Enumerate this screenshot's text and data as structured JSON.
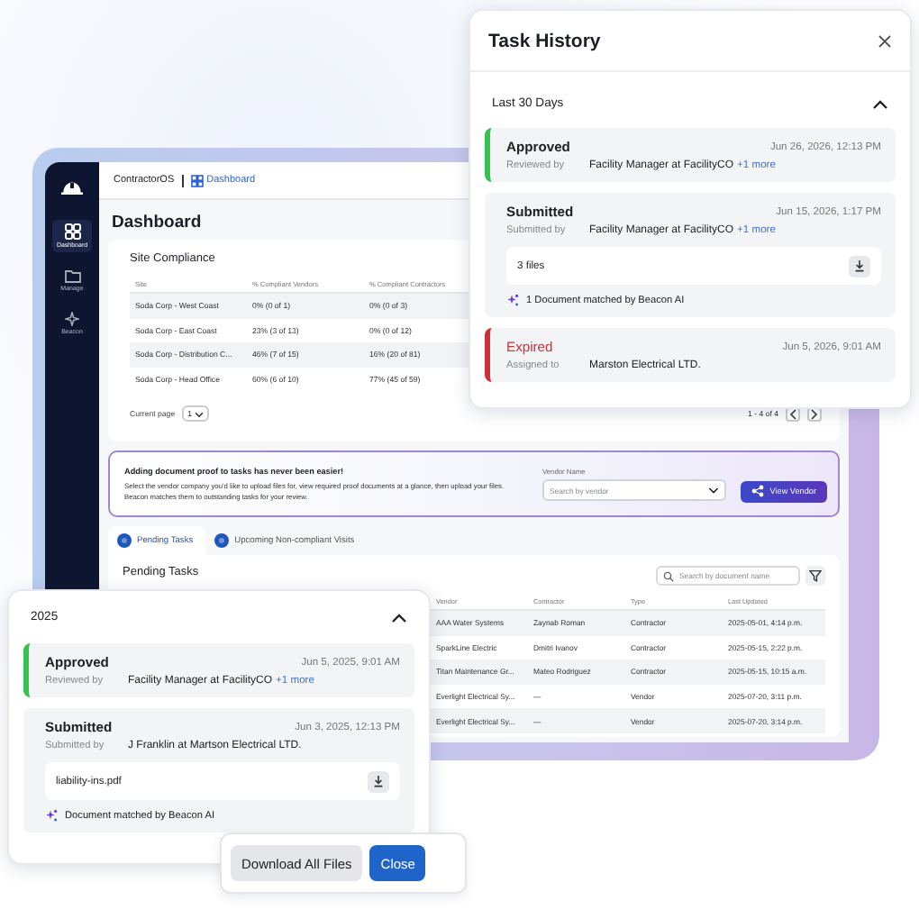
{
  "app": {
    "name": "ContractorOS",
    "breadcrumb": "Dashboard"
  },
  "sidebar": {
    "items": [
      {
        "label": "Dashboard",
        "selected": true
      },
      {
        "label": "Manage",
        "selected": false
      },
      {
        "label": "Beacon",
        "selected": false
      }
    ]
  },
  "page_title": "Dashboard",
  "site_compliance": {
    "title": "Site Compliance",
    "columns": [
      "Site",
      "% Compliant Vendors",
      "% Compliant Contractors"
    ],
    "rows": [
      [
        "Soda Corp - West Coast",
        "0% (0 of 1)",
        "0% (0 of 3)"
      ],
      [
        "Soda Corp - East Coast",
        "23% (3 of 13)",
        "0% (0 of 12)"
      ],
      [
        "Soda Corp - Distribution C...",
        "46% (7 of 15)",
        "16% (20 of 81)"
      ],
      [
        "Soda Corp - Head Office",
        "60% (6 of 10)",
        "77% (45 of 59)"
      ]
    ],
    "current_page_label": "Current page",
    "page": "1",
    "range": "1 - 4 of 4"
  },
  "banner": {
    "title": "Adding document proof to tasks has never been easier!",
    "text": "Select the vendor company you'd like to upload files for, view required proof documents at a glance, then upload your files. Beacon matches them to outstanding tasks for your review.",
    "field_label": "Vendor Name",
    "placeholder": "Search by vendor",
    "button": "View Vendor"
  },
  "tabs": [
    {
      "label": "Pending Tasks",
      "selected": true
    },
    {
      "label": "Upcoming Non-compliant Visits",
      "selected": false
    }
  ],
  "pending_tasks": {
    "title": "Pending Tasks",
    "search_placeholder": "Search by document name",
    "columns": [
      "Vendor",
      "Contractor",
      "Type",
      "Last Updated"
    ],
    "rows": [
      [
        "AAA Water Systems",
        "Zaynab Roman",
        "Contractor",
        "2025-05-01, 4:14 p.m."
      ],
      [
        "SparkLine Electric",
        "Dmitri Ivanov",
        "Contractor",
        "2025-05-15, 2:22 p.m."
      ],
      [
        "Titan Maintenance Gr...",
        "Mateo Rodriguez",
        "Contractor",
        "2025-05-15, 10:15 a.m."
      ],
      [
        "Everlight Electrical Sy...",
        "—",
        "Vendor",
        "2025-07-20, 3:11 p.m."
      ],
      [
        "Everlight Electrical Sy...",
        "—",
        "Vendor",
        "2025-07-20, 3:14 p.m."
      ]
    ]
  },
  "task_history": {
    "title": "Task History",
    "group": {
      "label": "Last 30 Days",
      "expanded": true,
      "entries": [
        {
          "kind": "approved",
          "status": "Approved",
          "date": "Jun 26, 2026, 12:13 PM",
          "by_label": "Reviewed by",
          "by": "Facility Manager at FacilityCO",
          "more": "+1 more"
        },
        {
          "kind": "submitted",
          "status": "Submitted",
          "date": "Jun 15, 2026, 1:17 PM",
          "by_label": "Submitted by",
          "by": "Facility Manager at FacilityCO",
          "more": "+1 more",
          "file": "3 files",
          "match": "1 Document matched by Beacon AI"
        },
        {
          "kind": "expired",
          "status": "Expired",
          "date": "Jun 5, 2026, 9:01 AM",
          "by_label": "Assigned to",
          "by": "Marston Electrical LTD."
        }
      ]
    }
  },
  "history_2025": {
    "label": "2025",
    "expanded": true,
    "entries": [
      {
        "kind": "approved",
        "status": "Approved",
        "date": "Jun 5, 2025, 9:01 AM",
        "by_label": "Reviewed by",
        "by": "Facility Manager at FacilityCO",
        "more": "+1 more"
      },
      {
        "kind": "submitted",
        "status": "Submitted",
        "date": "Jun 3, 2025, 12:13 PM",
        "by_label": "Submitted by",
        "by": "J Franklin at Martson Electrical LTD.",
        "file": "liability-ins.pdf",
        "match": "Document matched by Beacon AI"
      }
    ]
  },
  "footer_buttons": [
    {
      "label": "Download All Files",
      "kind": "secondary"
    },
    {
      "label": "Close",
      "kind": "primary"
    }
  ]
}
